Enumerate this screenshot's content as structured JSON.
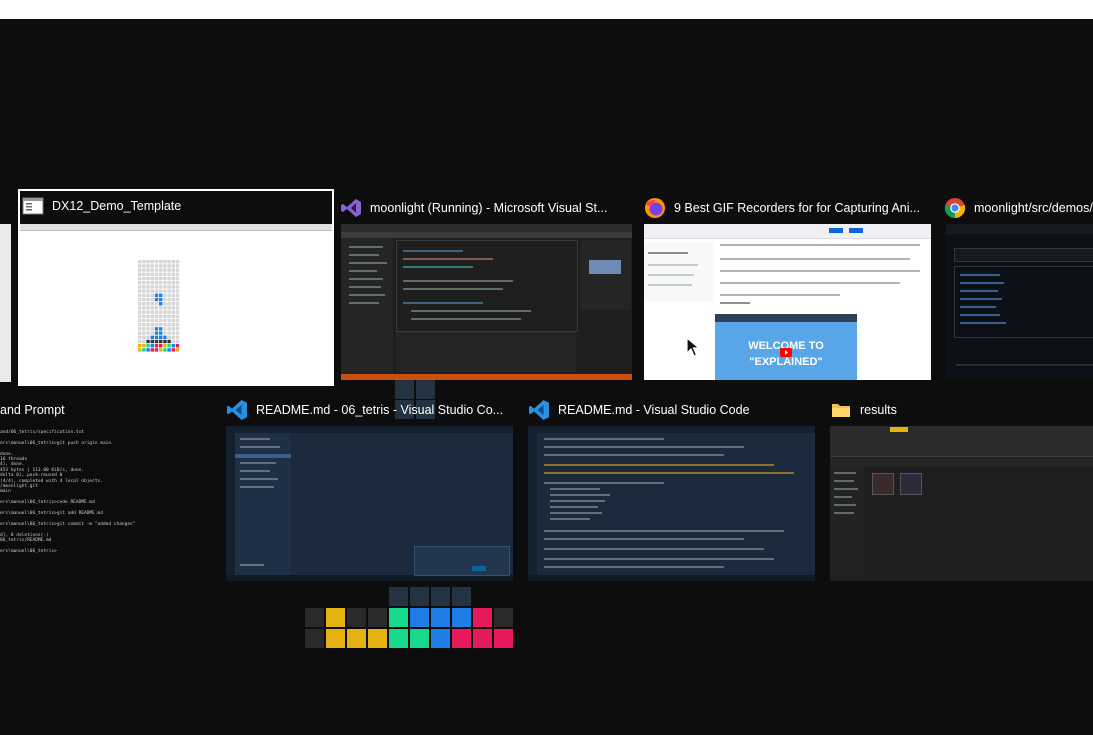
{
  "task_switcher": {
    "windows": [
      {
        "title": "DX12_Demo_Template",
        "icon": "window-app-icon",
        "selected": true
      },
      {
        "title": "moonlight (Running) - Microsoft Visual St...",
        "icon": "visual-studio-icon"
      },
      {
        "title": "9 Best GIF Recorders for for Capturing Ani...",
        "icon": "firefox-icon"
      },
      {
        "title": "moonlight/src/demos/",
        "icon": "chrome-icon"
      },
      {
        "title": "and Prompt",
        "icon": "terminal-icon"
      },
      {
        "title": "README.md - 06_tetris - Visual Studio Co...",
        "icon": "vscode-icon"
      },
      {
        "title": "README.md - Visual Studio Code",
        "icon": "vscode-icon"
      },
      {
        "title": "results",
        "icon": "folder-icon"
      }
    ],
    "browser_thumb_text": {
      "video_line1": "WELCOME TO",
      "video_line2": "\"EXPLAINED\""
    },
    "terminal_thumb_lines": [
      "and/06_tetris/specification.txt",
      "",
      "ers\\manuel\\06_tetris>git push origin main",
      "",
      "done.",
      "16 threads",
      "4), done.",
      "453 bytes | 113.00 KiB/s, done.",
      "delta 0), pack-reused 0",
      "(4/4), completed with 4 local objects.",
      "/moonlight.git",
      "main",
      "",
      "ers\\manuel\\06_tetris>code README.md",
      "",
      "ers\\manuel\\06_tetris>git add README.md",
      "",
      "ers\\manuel\\06_tetris>git commit -m \"added changes\"",
      "",
      "d], 0 deletions(-)",
      "06_tetris/README.md",
      "",
      "ers\\manuel\\06_tetris>"
    ]
  },
  "colors": {
    "background": "#0d0d0d",
    "selection": "#ffffff",
    "tetris_yellow": "#e6b212",
    "tetris_green": "#16d98c",
    "tetris_blue": "#1f7de6",
    "tetris_red": "#e6195a",
    "tetris_dark": "#2a2a2a",
    "tetris_slate": "#233342"
  }
}
